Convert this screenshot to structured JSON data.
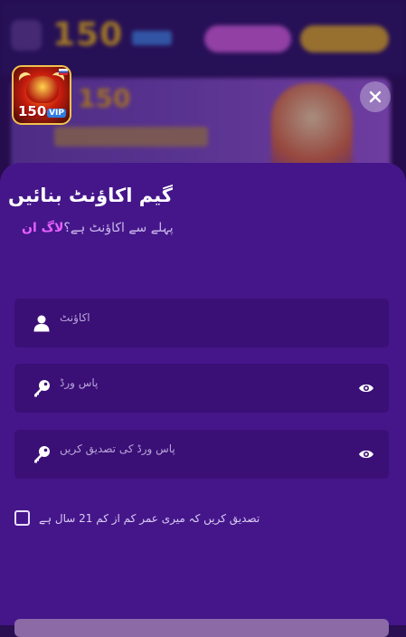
{
  "background": {
    "topbar_number": "150",
    "banner_number": "150"
  },
  "logo": {
    "number": "150",
    "badge": "VIP"
  },
  "modal": {
    "title": "گیم اکاؤنٹ بنائیں",
    "subtitle_prefix": "پہلے سے اکاؤنٹ ہے؟",
    "login_link": "لاگ ان",
    "fields": {
      "account_placeholder": "اکاؤنٹ",
      "password_placeholder": "پاس ورڈ",
      "confirm_placeholder": "پاس ورڈ کی تصدیق کریں"
    },
    "age_confirm": "تصدیق کریں کہ میری عمر کم از کم 21 سال ہے",
    "age_checked": false
  },
  "colors": {
    "sheet": "#45168a",
    "field": "#3a0f76",
    "link": "#e860ff"
  },
  "icons": [
    "close-icon",
    "user-icon",
    "key-icon",
    "eye-icon"
  ]
}
